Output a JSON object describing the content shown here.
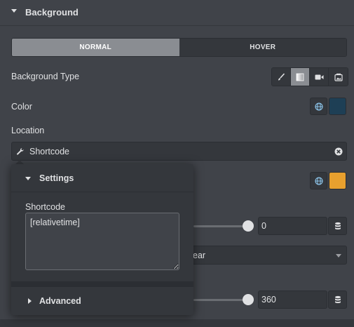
{
  "section": {
    "title": "Background"
  },
  "tabs": {
    "normal": "NORMAL",
    "hover": "HOVER"
  },
  "background_type": {
    "label": "Background Type",
    "options": [
      "brush-icon",
      "gradient-icon",
      "video-icon",
      "slideshow-icon"
    ],
    "active_index": 1
  },
  "color": {
    "label": "Color",
    "value": "#1e3f55"
  },
  "location": {
    "label": "Location",
    "value": "Shortcode"
  },
  "second_color": {
    "value": "#e8a02e"
  },
  "slider1": {
    "value": "0"
  },
  "dropdown_partial": "ear",
  "slider2": {
    "value": "360"
  },
  "popover": {
    "settings_title": "Settings",
    "shortcode_label": "Shortcode",
    "shortcode_value": "[relativetime]",
    "advanced_title": "Advanced"
  },
  "colors": {
    "accent_swatch": "#1e3f55",
    "orange_swatch": "#e8a02e",
    "active_tab": "#8a8d92",
    "panel": "#404349"
  }
}
